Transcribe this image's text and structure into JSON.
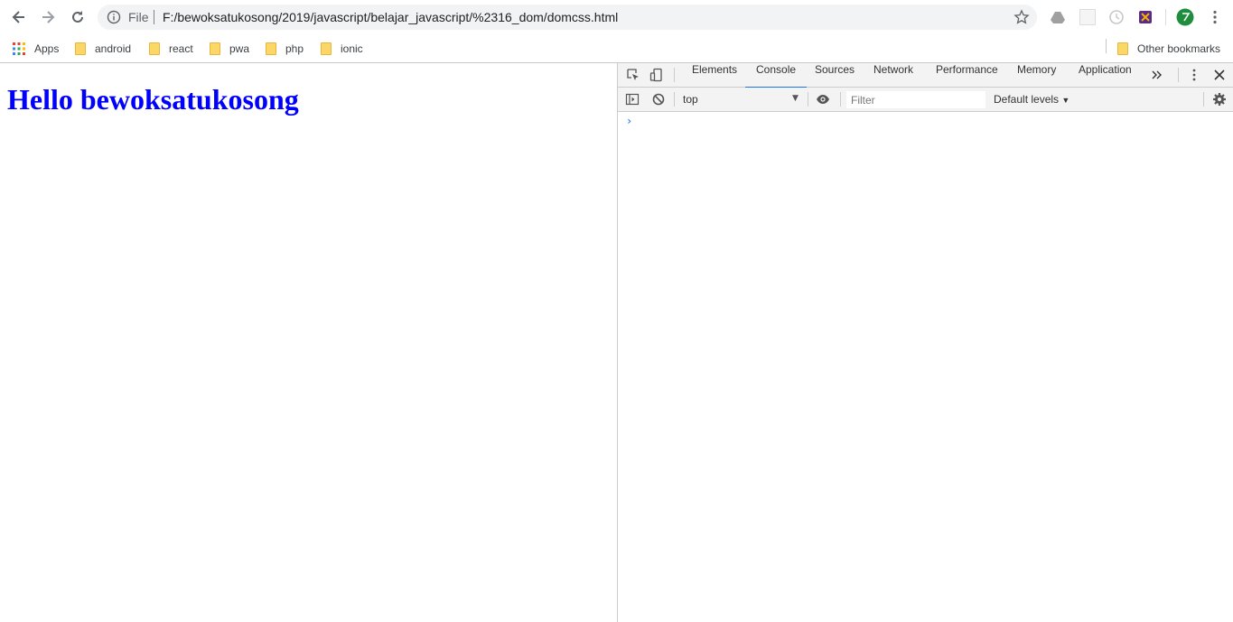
{
  "browser": {
    "omnibox": {
      "scheme_label": "File",
      "url": "F:/bewoksatukosong/2019/javascript/belajar_javascript/%2316_dom/domcss.html"
    },
    "bookmarks": [
      {
        "label": "Apps",
        "icon": "apps-grid-icon"
      },
      {
        "label": "android",
        "icon": "folder-icon"
      },
      {
        "label": "react",
        "icon": "folder-icon"
      },
      {
        "label": "pwa",
        "icon": "folder-icon"
      },
      {
        "label": "php",
        "icon": "folder-icon"
      },
      {
        "label": "ionic",
        "icon": "folder-icon"
      }
    ],
    "other_bookmarks": "Other bookmarks"
  },
  "page": {
    "heading": "Hello bewoksatukosong",
    "heading_color": "#0000ff"
  },
  "devtools": {
    "tabs": [
      "Elements",
      "Console",
      "Sources",
      "Network",
      "Performance",
      "Memory",
      "Application"
    ],
    "active_tab": "Console",
    "console": {
      "context": "top",
      "filter_placeholder": "Filter",
      "levels": "Default levels",
      "prompt": "›"
    },
    "accent_color": "#1a73e8"
  }
}
